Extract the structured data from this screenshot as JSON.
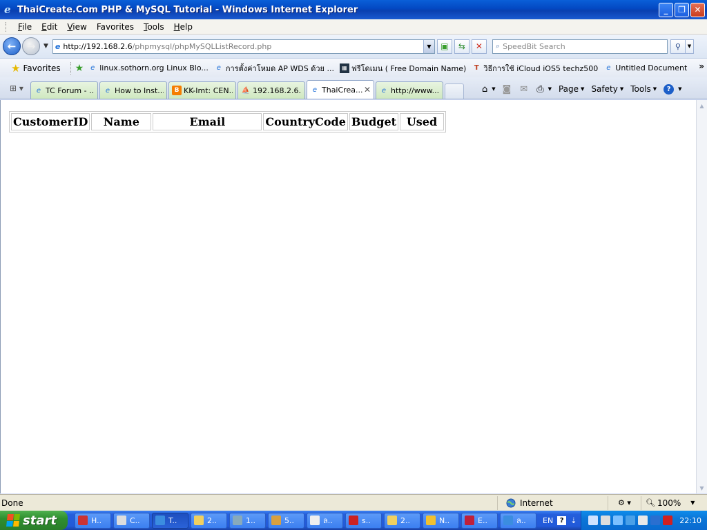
{
  "window": {
    "title": "ThaiCreate.Com PHP & MySQL Tutorial - Windows Internet Explorer",
    "buttons": [
      "minimize",
      "restore",
      "close"
    ]
  },
  "menu": {
    "items": [
      {
        "accel": "F",
        "rest": "ile"
      },
      {
        "accel": "E",
        "rest": "dit"
      },
      {
        "accel": "V",
        "rest": "iew"
      },
      {
        "accel": "",
        "rest": "Favorites"
      },
      {
        "accel": "T",
        "rest": "ools"
      },
      {
        "accel": "H",
        "rest": "elp"
      }
    ]
  },
  "address": {
    "host": "http://192.168.2.6",
    "path": "/phpmysql/phpMySQLListRecord.php",
    "search_placeholder": "SpeedBit Search"
  },
  "favorites": {
    "label": "Favorites",
    "links": [
      "linux.sothorn.org  Linux Blo...",
      "การตั้งค่าโหมด AP WDS ด้วย ...",
      "ฟรีโดเมน ( Free Domain Name)",
      "วิธีการใช้ iCloud iOS5  techz500",
      "Untitled Document"
    ]
  },
  "tabs": [
    {
      "label": "TC Forum - ..."
    },
    {
      "label": "How to Inst..."
    },
    {
      "label": "KK-Imt: CEN..."
    },
    {
      "label": "192.168.2.6..."
    },
    {
      "label": "ThaiCrea..."
    },
    {
      "label": "http://www...."
    }
  ],
  "commands": {
    "page": "Page",
    "safety": "Safety",
    "tools": "Tools"
  },
  "table": {
    "headers": [
      "CustomerID",
      "Name",
      "Email",
      "CountryCode",
      "Budget",
      "Used"
    ]
  },
  "status": {
    "text": "Done",
    "zone": "Internet",
    "zoom": "100%"
  },
  "taskbar": {
    "start": "start",
    "tasks": [
      "H..",
      "C..",
      "T..",
      "2..",
      "1..",
      "5..",
      "ล..",
      "s..",
      "2..",
      "N..",
      "E..",
      "ล.."
    ],
    "lang": "EN",
    "clock": "22:10"
  },
  "colors": {
    "titlebar": "#0348c2",
    "tab_inactive": "#cfe8c0",
    "taskbar": "#245edb",
    "start": "#2f8f2f"
  }
}
